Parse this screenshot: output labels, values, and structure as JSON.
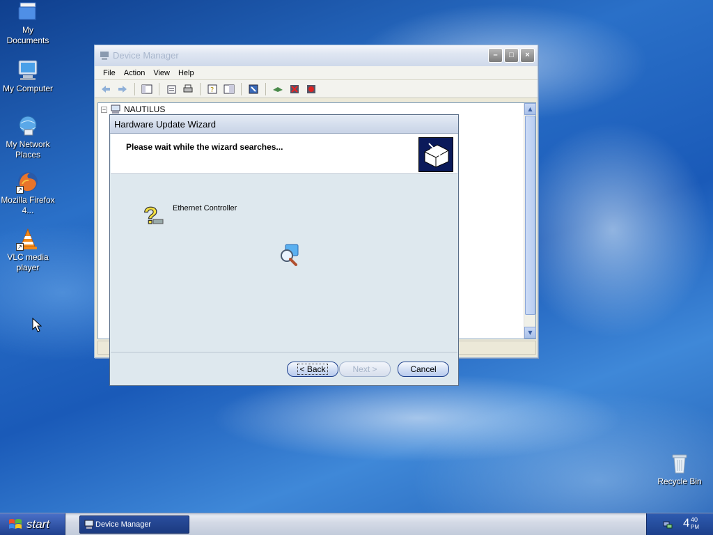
{
  "desktop": {
    "icons": [
      {
        "label": "My\nDocuments"
      },
      {
        "label": "My Computer"
      },
      {
        "label": "My Network Places"
      },
      {
        "label": "Mozilla Firefox 4..."
      },
      {
        "label": "VLC media player"
      },
      {
        "label": "Recycle Bin"
      }
    ]
  },
  "device_manager": {
    "title": "Device Manager",
    "menu": [
      "File",
      "Action",
      "View",
      "Help"
    ],
    "tree_root": "NAUTILUS",
    "controls": {
      "minimize": "–",
      "maximize": "□",
      "close": "×"
    }
  },
  "wizard": {
    "title": "Hardware Update Wizard",
    "heading": "Please wait while the wizard searches...",
    "device": "Ethernet Controller",
    "buttons": {
      "back": "< Back",
      "next": "Next >",
      "cancel": "Cancel"
    }
  },
  "taskbar": {
    "start_label": "start",
    "task_item": "Device Manager",
    "clock_hour": "4",
    "clock_minute": "40",
    "clock_ampm": "PM"
  },
  "colors": {
    "accent": "#1c3f8c",
    "desktop_blue": "#2a70c8"
  }
}
